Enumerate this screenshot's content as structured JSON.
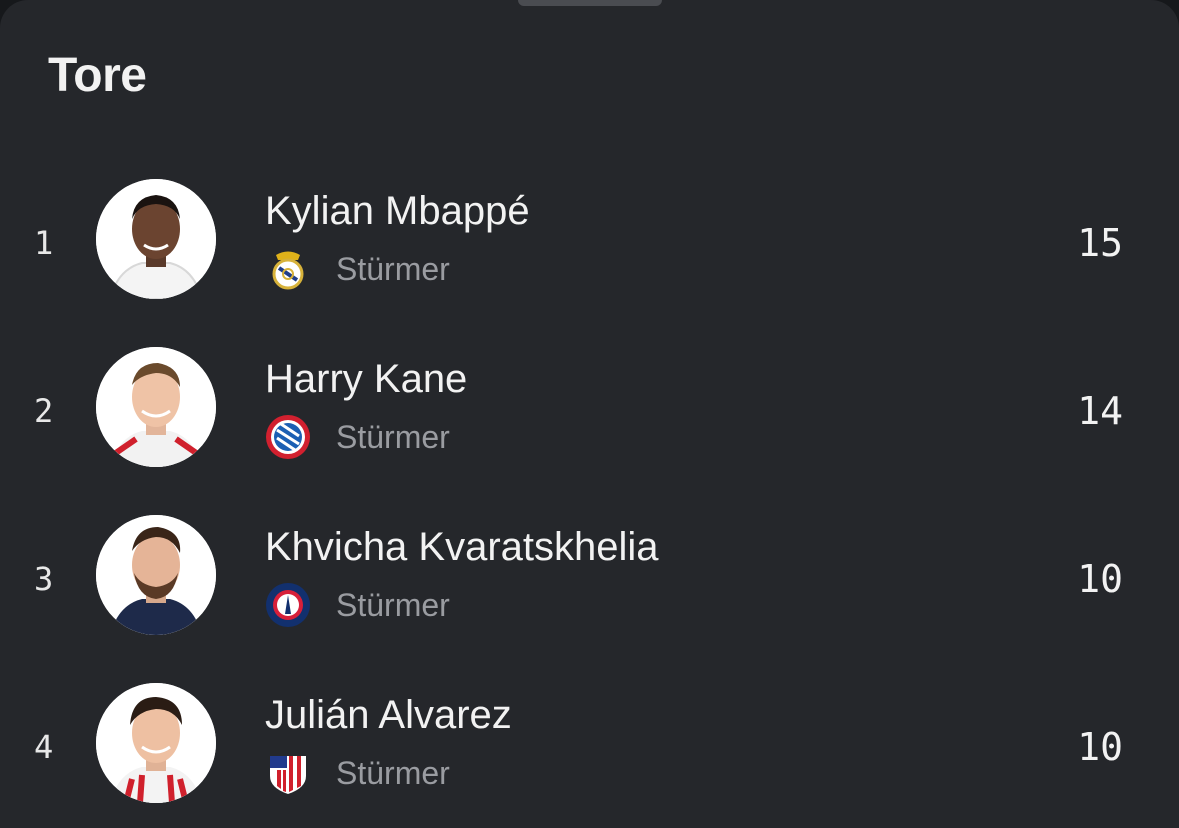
{
  "header": {
    "title": "Tore"
  },
  "players": [
    {
      "rank": "1",
      "name": "Kylian Mbappé",
      "position": "Stürmer",
      "goals": "15",
      "club_icon": "real-madrid-crest-icon",
      "avatar": "player-photo"
    },
    {
      "rank": "2",
      "name": "Harry Kane",
      "position": "Stürmer",
      "goals": "14",
      "club_icon": "fc-bayern-crest-icon",
      "avatar": "player-photo"
    },
    {
      "rank": "3",
      "name": "Khvicha Kvaratskhelia",
      "position": "Stürmer",
      "goals": "10",
      "club_icon": "psg-crest-icon",
      "avatar": "player-photo"
    },
    {
      "rank": "4",
      "name": "Julián Alvarez",
      "position": "Stürmer",
      "goals": "10",
      "club_icon": "atletico-madrid-crest-icon",
      "avatar": "player-photo"
    }
  ],
  "colors": {
    "background": "#25272b",
    "text_primary": "#f2f2f2",
    "text_secondary": "#9a9ca1"
  }
}
